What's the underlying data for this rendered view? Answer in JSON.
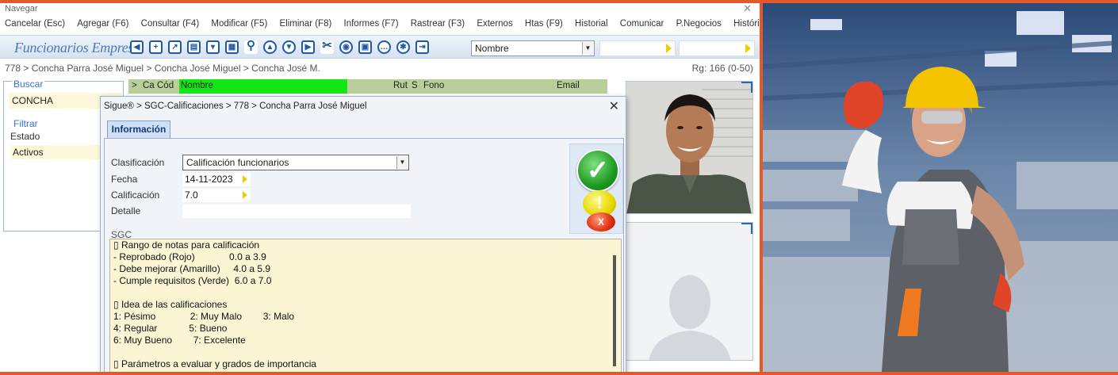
{
  "window": {
    "title": "Navegar",
    "close_glyph": "✕"
  },
  "menu": [
    "Cancelar (Esc)",
    "Agregar (F6)",
    "Consultar (F4)",
    "Modificar (F5)",
    "Eliminar (F8)",
    "Informes (F7)",
    "Rastrear (F3)",
    "Externos",
    "Htas (F9)",
    "Historial",
    "Comunicar",
    "P.Negocios",
    "Histórico"
  ],
  "toolbar": {
    "app_title": "Funcionarios Empresa",
    "order_select": "Nombre"
  },
  "breadcrumb": {
    "path": "778  >  Concha Parra José Miguel  >  Concha José Miguel  >  Concha José M.",
    "records": "Rg: 166 (0-50)"
  },
  "search": {
    "legend": "Buscar",
    "value": "CONCHA"
  },
  "filter": {
    "legend": "Filtrar",
    "state_label": "Estado",
    "state_value": "Activos"
  },
  "grid": {
    "columns": [
      ">",
      "Ca",
      "Cód",
      "Nombre",
      "Rut",
      "S",
      "Fono",
      "Email"
    ]
  },
  "dialog": {
    "title": "Sigue® > SGC-Calificaciones > 778 > Concha Parra José Miguel",
    "tab": "Información",
    "fields": {
      "clasificacion_label": "Clasificación",
      "clasificacion_value": "Calificación funcionarios",
      "fecha_label": "Fecha",
      "fecha_value": "14-11-2023",
      "calificacion_label": "Calificación",
      "calificacion_value": "7.0",
      "detalle_label": "Detalle",
      "detalle_value": ""
    },
    "buttons": {
      "ok": "✓",
      "warn": "!",
      "cancel": "X"
    },
    "sgc_label": "SGC",
    "sgc_text": "▯ Rango de notas para calificación\n- Reprobado (Rojo)             0.0 a 3.9\n- Debe mejorar (Amarillo)     4.0 a 5.9\n- Cumple requisitos (Verde)  6.0 a 7.0\n\n▯ Idea de las calificaciones\n1: Pésimo             2: Muy Malo        3: Malo\n4: Regular            5: Bueno\n6: Muy Bueno        7: Excelente\n\n▯ Parámetros a evaluar y grados de importancia"
  },
  "colors": {
    "accent": "#2c63b8",
    "name_header": "#14e614",
    "frame": "#e25a2a",
    "field_bg": "#fdf7dc"
  }
}
